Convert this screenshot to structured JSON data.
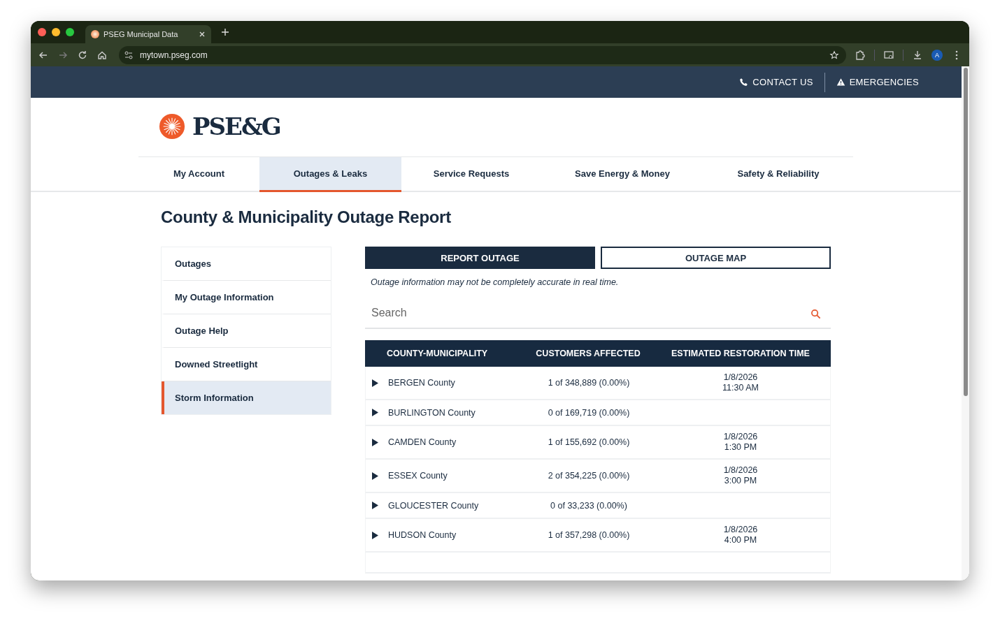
{
  "browser": {
    "tab_title": "PSEG Municipal Data",
    "url": "mytown.pseg.com",
    "profile_initial": "A"
  },
  "utility_bar": [
    {
      "label": "CONTACT US",
      "kind": "phone"
    },
    {
      "label": "EMERGENCIES",
      "kind": "warning"
    }
  ],
  "logo": {
    "text": "PSE&G"
  },
  "nav": [
    {
      "label": "My Account",
      "selected": false
    },
    {
      "label": "Outages & Leaks",
      "selected": true
    },
    {
      "label": "Service Requests",
      "selected": false
    },
    {
      "label": "Save Energy & Money",
      "selected": false
    },
    {
      "label": "Safety & Reliability",
      "selected": false
    }
  ],
  "page_title": "County & Municipality Outage Report",
  "sidebar": [
    {
      "label": "Outages",
      "selected": false
    },
    {
      "label": "My Outage Information",
      "selected": false
    },
    {
      "label": "Outage Help",
      "selected": false
    },
    {
      "label": "Downed Streetlight",
      "selected": false
    },
    {
      "label": "Storm Information",
      "selected": true
    }
  ],
  "buttons": [
    {
      "label": "REPORT OUTAGE",
      "kind": "primary"
    },
    {
      "label": "OUTAGE MAP",
      "kind": "outline"
    }
  ],
  "notice": "Outage information may not be completely accurate in real time.",
  "search": {
    "placeholder": "Search"
  },
  "table": {
    "columns": [
      "COUNTY-MUNICIPALITY",
      "CUSTOMERS AFFECTED",
      "ESTIMATED RESTORATION TIME"
    ],
    "rows": [
      {
        "county": "BERGEN County",
        "affected": "1 of 348,889 (0.00%)",
        "restoration": [
          "1/8/2026",
          "11:30 AM"
        ],
        "expanded": false
      },
      {
        "county": "BURLINGTON County",
        "affected": "0 of 169,719 (0.00%)",
        "restoration": [],
        "expanded": false
      },
      {
        "county": "CAMDEN County",
        "affected": "1 of 155,692 (0.00%)",
        "restoration": [
          "1/8/2026",
          "1:30 PM"
        ],
        "expanded": false
      },
      {
        "county": "ESSEX County",
        "affected": "2 of 354,225 (0.00%)",
        "restoration": [
          "1/8/2026",
          "3:00 PM"
        ],
        "expanded": false
      },
      {
        "county": "GLOUCESTER County",
        "affected": "0 of 33,233 (0.00%)",
        "restoration": [],
        "expanded": false
      },
      {
        "county": "HUDSON County",
        "affected": "1 of 357,298 (0.00%)",
        "restoration": [
          "1/8/2026",
          "4:00 PM"
        ],
        "expanded": false
      }
    ]
  }
}
